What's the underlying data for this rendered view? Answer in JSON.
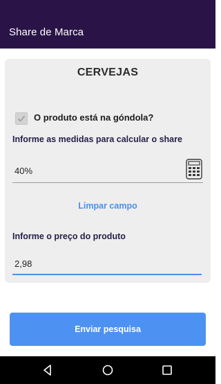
{
  "appbar": {
    "title": "Share de Marca"
  },
  "card": {
    "title": "CERVEJAS",
    "in_shelf": {
      "label": "O produto está na góndola?",
      "checked": true
    },
    "measure_label": "Informe as medidas para calcular o share",
    "share_value": "40%",
    "clear_label": "Limpar campo",
    "price_label": "Informe o preço do produto",
    "price_value": "2,98"
  },
  "submit_label": "Enviar pesquisa",
  "icons": {
    "calculator": "calculator-icon",
    "check": "check-icon",
    "nav": [
      "back-icon",
      "home-icon",
      "recents-icon"
    ]
  },
  "colors": {
    "appbar": "#2a1447",
    "card": "#eeeeee",
    "accent": "#4d92f2",
    "label": "#262047",
    "navbar": "#000000"
  }
}
